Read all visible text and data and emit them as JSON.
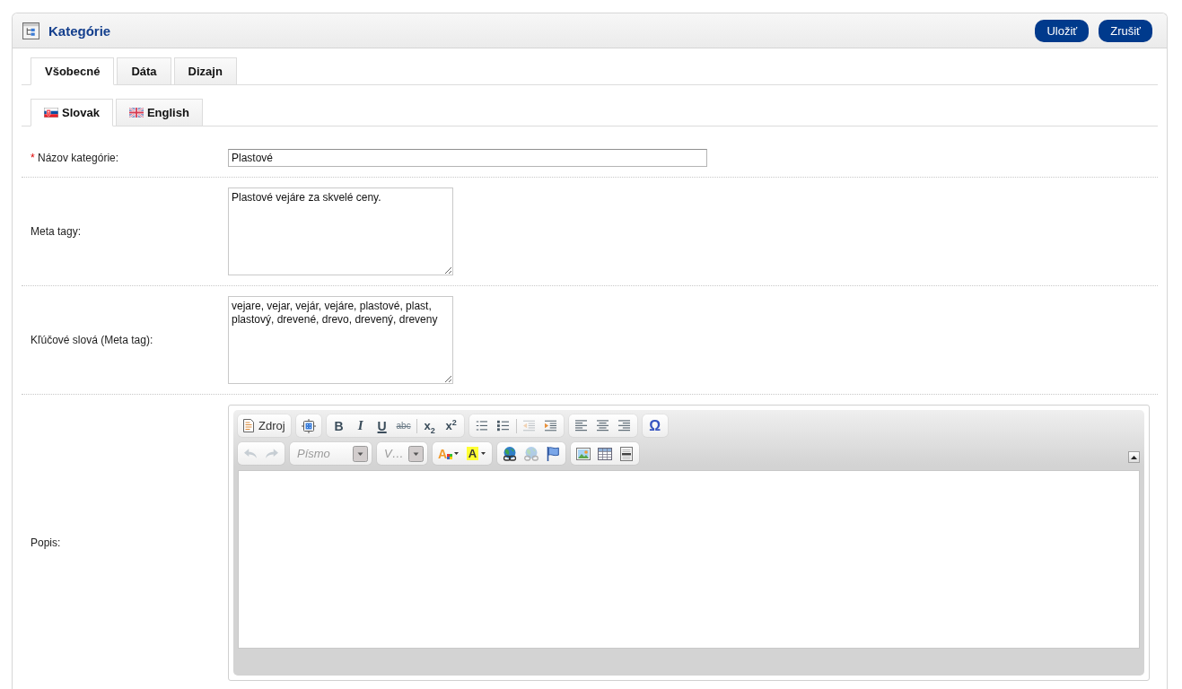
{
  "panel": {
    "title": "Kategórie",
    "actions": [
      "Uložiť",
      "Zrušiť"
    ]
  },
  "tabs": [
    {
      "label": "Všobecné",
      "selected": true
    },
    {
      "label": "Dáta",
      "selected": false
    },
    {
      "label": "Dizajn",
      "selected": false
    }
  ],
  "language_tabs": [
    {
      "kind": "sk",
      "label": "Slovak",
      "selected": true
    },
    {
      "kind": "gb",
      "label": "English",
      "selected": false
    }
  ],
  "form": {
    "fields": [
      {
        "kind": "text",
        "required_mark": "*",
        "label": "Názov kategórie:",
        "value": "Plastové"
      },
      {
        "kind": "textarea",
        "label": "Meta tagy:",
        "value": "Plastové vejáre za skvelé ceny."
      },
      {
        "kind": "textarea",
        "label": "Kľúčové slová (Meta tag):",
        "value": "vejare, vejar, vejár, vejáre, plastové, plast, plastový, drevené, drevo, drevený, dreveny"
      },
      {
        "kind": "editor",
        "label": "Popis:",
        "toolbar_collapsed": false,
        "toolbar": [
          {
            "groups": [
              {
                "sections": [
                  [
                    {
                      "kind": "source",
                      "label": "Zdroj",
                      "disabled": false
                    }
                  ]
                ]
              },
              {
                "sections": [
                  [
                    {
                      "kind": "show-blocks",
                      "disabled": false
                    }
                  ]
                ]
              },
              {
                "sections": [
                  [
                    {
                      "kind": "bold",
                      "label": "B",
                      "disabled": false
                    },
                    {
                      "kind": "italic",
                      "label": "I",
                      "disabled": false
                    },
                    {
                      "kind": "underline",
                      "label": "U",
                      "disabled": false
                    },
                    {
                      "kind": "strike",
                      "label": "abc",
                      "disabled": false
                    }
                  ],
                  [
                    {
                      "kind": "subscript",
                      "label": "x$_{2}$",
                      "disabled": false
                    },
                    {
                      "kind": "superscript",
                      "label": "x$^{2}$",
                      "disabled": false
                    }
                  ]
                ]
              },
              {
                "sections": [
                  [
                    {
                      "kind": "numbered-list",
                      "disabled": false
                    },
                    {
                      "kind": "bulleted-list",
                      "disabled": false
                    }
                  ],
                  [
                    {
                      "kind": "outdent",
                      "disabled": true
                    },
                    {
                      "kind": "indent",
                      "disabled": false
                    }
                  ]
                ]
              },
              {
                "sections": [
                  [
                    {
                      "kind": "align-left",
                      "disabled": false
                    },
                    {
                      "kind": "align-center",
                      "disabled": false
                    },
                    {
                      "kind": "align-right",
                      "disabled": false
                    }
                  ]
                ]
              },
              {
                "sections": [
                  [
                    {
                      "kind": "special-char",
                      "label": "Ω",
                      "disabled": false
                    }
                  ]
                ]
              }
            ]
          },
          {
            "groups": [
              {
                "sections": [
                  [
                    {
                      "kind": "undo",
                      "disabled": true
                    },
                    {
                      "kind": "redo",
                      "disabled": true
                    }
                  ]
                ]
              },
              {
                "sections": [
                  [
                    {
                      "kind": "font",
                      "placeholder": "Písmo",
                      "disabled": false
                    }
                  ]
                ]
              },
              {
                "sections": [
                  [
                    {
                      "kind": "size",
                      "placeholder": "V…",
                      "disabled": false
                    }
                  ]
                ]
              },
              {
                "sections": [
                  [
                    {
                      "kind": "text-color",
                      "label": "A",
                      "disabled": false
                    },
                    {
                      "kind": "bg-color",
                      "label": "A",
                      "disabled": false
                    }
                  ]
                ]
              },
              {
                "sections": [
                  [
                    {
                      "kind": "link",
                      "disabled": false
                    },
                    {
                      "kind": "unlink",
                      "disabled": true
                    },
                    {
                      "kind": "anchor",
                      "disabled": false
                    }
                  ]
                ]
              },
              {
                "sections": [
                  [
                    {
                      "kind": "image",
                      "disabled": false
                    },
                    {
                      "kind": "table",
                      "disabled": false
                    },
                    {
                      "kind": "horizontal-rule",
                      "disabled": false
                    }
                  ]
                ]
              }
            ]
          }
        ]
      }
    ]
  }
}
